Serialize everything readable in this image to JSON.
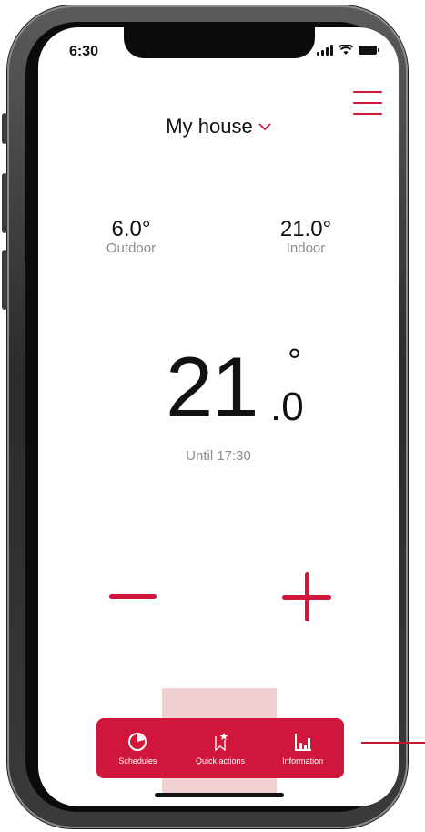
{
  "status_bar": {
    "time": "6:30"
  },
  "header": {
    "title": "My house"
  },
  "temperatures": {
    "outdoor": {
      "value": "6.0°",
      "label": "Outdoor"
    },
    "indoor": {
      "value": "21.0°",
      "label": "Indoor"
    }
  },
  "setpoint": {
    "integer": "21",
    "degree": "°",
    "decimal": ".0",
    "until": "Until 17:30"
  },
  "nav": [
    {
      "label": "Schedules",
      "icon": "schedule-icon"
    },
    {
      "label": "Quick actions",
      "icon": "quick-actions-icon"
    },
    {
      "label": "Information",
      "icon": "chart-icon"
    }
  ],
  "colors": {
    "accent": "#d0163b",
    "muted_text": "#8c8c8c"
  }
}
